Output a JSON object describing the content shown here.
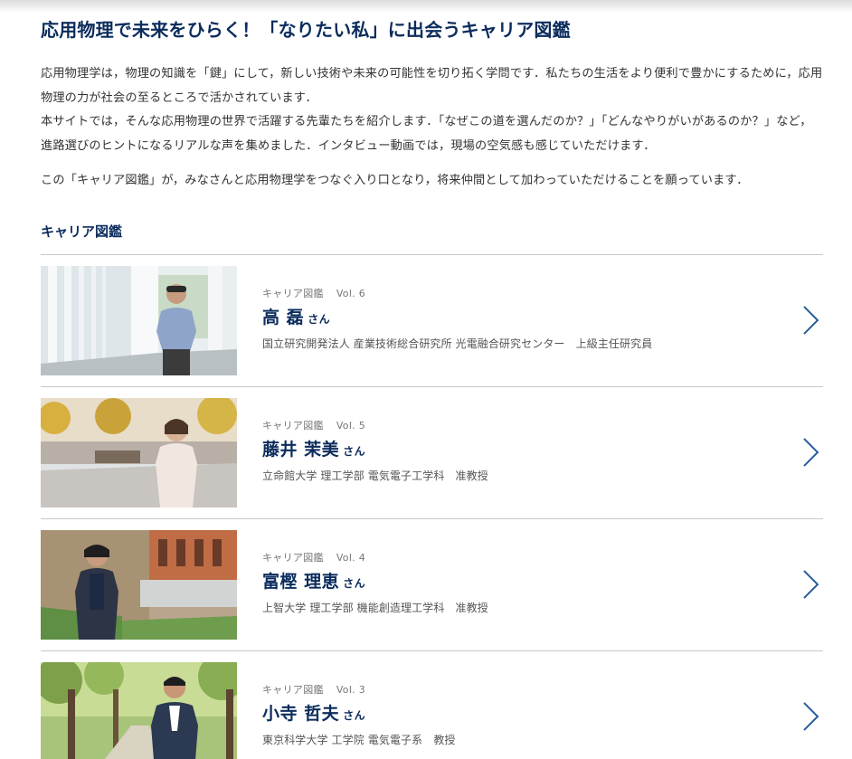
{
  "page": {
    "title": "応用物理で未来をひらく！「なりたい私」に出会うキャリア図鑑",
    "intro": [
      "応用物理学は，物理の知識を「鍵」にして，新しい技術や未来の可能性を切り拓く学問です．私たちの生活をより便利で豊かにするために，応用物理の力が社会の至るところで活かされています．",
      "本サイトでは，そんな応用物理の世界で活躍する先輩たちを紹介します．「なぜこの道を選んだのか？」「どんなやりがいがあるのか？」など，進路選びのヒントになるリアルな声を集めました．インタビュー動画では，現場の空気感も感じていただけます．",
      "この「キャリア図鑑」が，みなさんと応用物理学をつなぐ入り口となり，将来仲間として加わっていただけることを願っています．"
    ],
    "section_title": "キャリア図鑑"
  },
  "colors": {
    "accent": "#0b2c5c",
    "chevron": "#2a5d9a",
    "divider": "#c7c7c7"
  },
  "entries": [
    {
      "series": "キャリア図鑑",
      "vol": "Vol. 6",
      "name": "高 磊",
      "honorific": "さん",
      "affiliation": "国立研究開発法人 産業技術総合研究所 光電融合研究センター　上級主任研究員",
      "icon": "chevron-right-icon"
    },
    {
      "series": "キャリア図鑑",
      "vol": "Vol. 5",
      "name": "藤井 茉美",
      "honorific": "さん",
      "affiliation": "立命館大学 理工学部 電気電子工学科　准教授",
      "icon": "chevron-right-icon"
    },
    {
      "series": "キャリア図鑑",
      "vol": "Vol. 4",
      "name": "富樫 理恵",
      "honorific": "さん",
      "affiliation": "上智大学 理工学部 機能創造理工学科　准教授",
      "icon": "chevron-right-icon"
    },
    {
      "series": "キャリア図鑑",
      "vol": "Vol. 3",
      "name": "小寺 哲夫",
      "honorific": "さん",
      "affiliation": "東京科学大学 工学院 電気電子系　教授",
      "icon": "chevron-right-icon"
    }
  ]
}
